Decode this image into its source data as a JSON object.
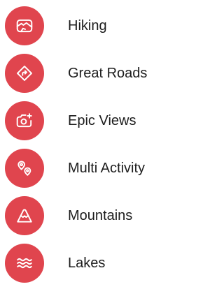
{
  "theme": {
    "accent": "#e0454e",
    "icon_color": "#ffffff",
    "text_color": "#1c1c1c"
  },
  "categories": [
    {
      "label": "Hiking",
      "icon": "hiking-icon"
    },
    {
      "label": "Great Roads",
      "icon": "route-icon"
    },
    {
      "label": "Epic Views",
      "icon": "camera-icon"
    },
    {
      "label": "Multi Activity",
      "icon": "multi-location-icon"
    },
    {
      "label": "Mountains",
      "icon": "mountain-icon"
    },
    {
      "label": "Lakes",
      "icon": "waves-icon"
    }
  ]
}
